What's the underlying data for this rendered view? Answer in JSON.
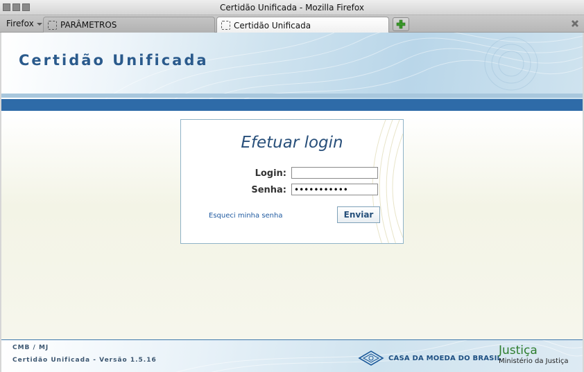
{
  "window": {
    "title": "Certidão Unificada - Mozilla Firefox"
  },
  "browser": {
    "menu_label": "Firefox",
    "tabs": [
      {
        "label": "PARÂMETROS",
        "active": false
      },
      {
        "label": "Certidão Unificada",
        "active": true
      }
    ]
  },
  "header": {
    "title": "Certidão Unificada"
  },
  "login": {
    "heading": "Efetuar login",
    "login_label": "Login:",
    "login_value": "",
    "password_label": "Senha:",
    "password_value": "•••••••••••",
    "forgot_link": "Esqueci minha senha",
    "submit_label": "Enviar"
  },
  "footer": {
    "line1": "CMB / MJ",
    "line2": "Certidão Unificada - Versão 1.5.16",
    "cmb_logo_text": "CASA DA MOEDA DO BRASIL",
    "mj_logo_line1": "Justiça",
    "mj_logo_line2": "Ministério da Justiça"
  },
  "colors": {
    "accent_blue": "#2e6ba8",
    "title_blue": "#2a5a8c",
    "mj_green": "#2e7d2e"
  }
}
